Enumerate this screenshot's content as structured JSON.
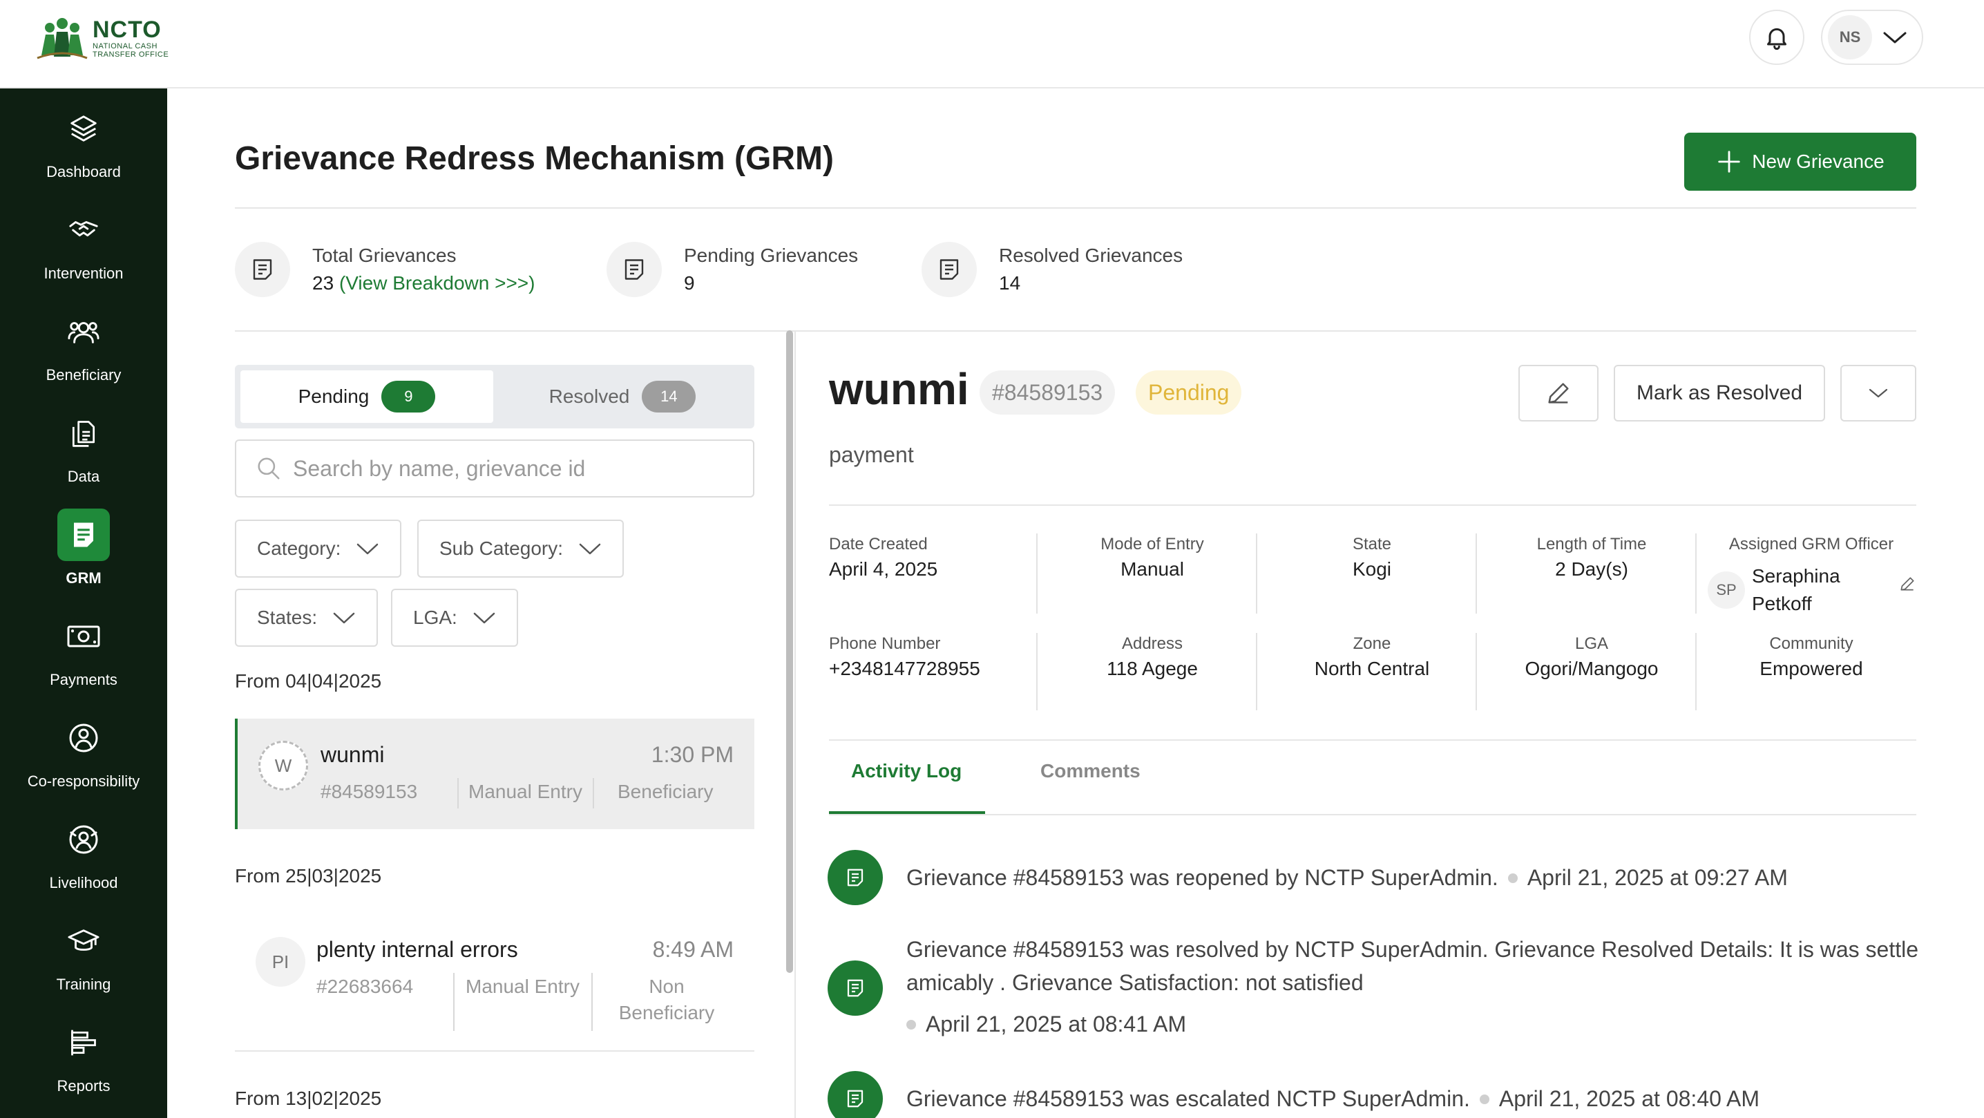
{
  "brand": {
    "title": "NCTO",
    "subtitle_1": "NATIONAL CASH",
    "subtitle_2": "TRANSFER OFFICE"
  },
  "user": {
    "initials": "NS"
  },
  "sidebar": {
    "items": [
      {
        "label": "Dashboard",
        "icon": "layers-icon"
      },
      {
        "label": "Intervention",
        "icon": "handshake-icon"
      },
      {
        "label": "Beneficiary",
        "icon": "users-icon"
      },
      {
        "label": "Data",
        "icon": "documents-icon"
      },
      {
        "label": "GRM",
        "icon": "grm-icon",
        "active": true
      },
      {
        "label": "Payments",
        "icon": "money-icon"
      },
      {
        "label": "Co-responsibility",
        "icon": "co-responsibility-icon"
      },
      {
        "label": "Livelihood",
        "icon": "livelihood-icon"
      },
      {
        "label": "Training",
        "icon": "graduation-cap-icon"
      },
      {
        "label": "Reports",
        "icon": "reports-icon"
      }
    ]
  },
  "header": {
    "title": "Grievance Redress Mechanism (GRM)",
    "new_button": "New Grievance"
  },
  "stats": {
    "total": {
      "label": "Total Grievances",
      "value": "23",
      "link": "(View Breakdown >>>)"
    },
    "pending": {
      "label": "Pending Grievances",
      "value": "9"
    },
    "resolved": {
      "label": "Resolved Grievances",
      "value": "14"
    }
  },
  "list": {
    "tabs": [
      {
        "label": "Pending",
        "count": "9"
      },
      {
        "label": "Resolved",
        "count": "14"
      }
    ],
    "search_placeholder": "Search by name, grievance id",
    "filters": {
      "category": "Category:",
      "sub_category": "Sub Category:",
      "states": "States:",
      "lga": "LGA:"
    },
    "groups": [
      {
        "label": "From 04|04|2025",
        "items": [
          {
            "initials": "W",
            "name": "wunmi",
            "time": "1:30 PM",
            "id": "#84589153",
            "entry": "Manual Entry",
            "type": "Beneficiary"
          }
        ]
      },
      {
        "label": "From 25|03|2025",
        "items": [
          {
            "initials": "PI",
            "name": "plenty internal errors",
            "time": "8:49 AM",
            "id": "#22683664",
            "entry": "Manual Entry",
            "type_1": "Non",
            "type_2": "Beneficiary"
          }
        ]
      },
      {
        "label": "From 13|02|2025"
      }
    ]
  },
  "detail": {
    "name": "wunmi",
    "id": "#84589153",
    "status": "Pending",
    "status_color": "#e0b53a",
    "resolve_button": "Mark as Resolved",
    "category": "payment",
    "info": {
      "date_created": {
        "label": "Date Created",
        "value": "April 4, 2025"
      },
      "mode_of_entry": {
        "label": "Mode of Entry",
        "value": "Manual"
      },
      "state": {
        "label": "State",
        "value": "Kogi"
      },
      "length_of_time": {
        "label": "Length of Time",
        "value": "2 Day(s)"
      },
      "officer": {
        "label": "Assigned GRM Officer",
        "initials": "SP",
        "name": "Seraphina Petkoff"
      },
      "phone": {
        "label": "Phone Number",
        "value": "+2348147728955"
      },
      "address": {
        "label": "Address",
        "value": "118 Agege"
      },
      "zone": {
        "label": "Zone",
        "value": "North Central"
      },
      "lga": {
        "label": "LGA",
        "value": "Ogori/Mangogo"
      },
      "community": {
        "label": "Community",
        "value": "Empowered"
      }
    },
    "tabs": {
      "activity": "Activity Log",
      "comments": "Comments"
    },
    "activity": [
      {
        "text": "Grievance #84589153 was reopened by NCTP SuperAdmin.",
        "date": "April 21, 2025 at 09:27 AM"
      },
      {
        "text": "Grievance #84589153 was resolved by NCTP SuperAdmin. Grievance Resolved Details: It is was settle amicably . Grievance Satisfaction: not satisfied",
        "date": "April 21, 2025 at 08:41 AM"
      },
      {
        "text": "Grievance #84589153 was escalated NCTP SuperAdmin.",
        "date": "April 21, 2025 at 08:40 AM"
      }
    ]
  },
  "colors": {
    "brand_green": "#1e7b34",
    "sidebar_bg": "#0e1f12",
    "pending_bg": "#fdf6dc"
  }
}
